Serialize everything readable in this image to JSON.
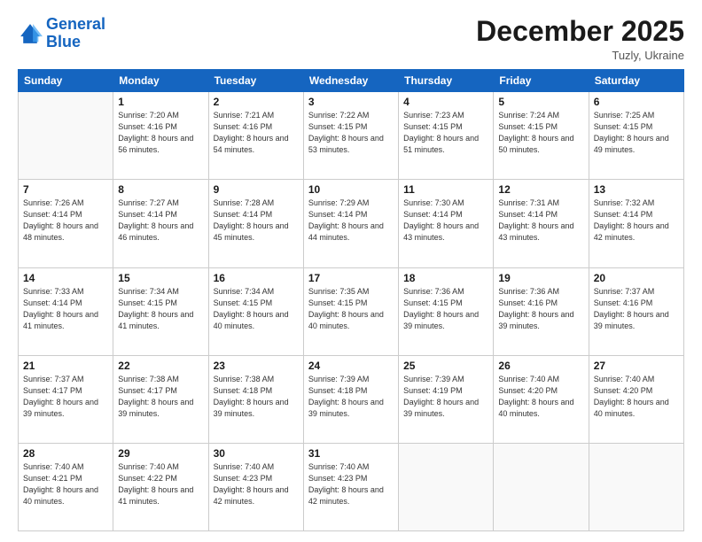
{
  "header": {
    "logo_line1": "General",
    "logo_line2": "Blue",
    "month_title": "December 2025",
    "subtitle": "Tuzly, Ukraine"
  },
  "weekdays": [
    "Sunday",
    "Monday",
    "Tuesday",
    "Wednesday",
    "Thursday",
    "Friday",
    "Saturday"
  ],
  "weeks": [
    [
      {
        "day": "",
        "sunrise": "",
        "sunset": "",
        "daylight": "",
        "empty": true
      },
      {
        "day": "1",
        "sunrise": "Sunrise: 7:20 AM",
        "sunset": "Sunset: 4:16 PM",
        "daylight": "Daylight: 8 hours and 56 minutes.",
        "empty": false
      },
      {
        "day": "2",
        "sunrise": "Sunrise: 7:21 AM",
        "sunset": "Sunset: 4:16 PM",
        "daylight": "Daylight: 8 hours and 54 minutes.",
        "empty": false
      },
      {
        "day": "3",
        "sunrise": "Sunrise: 7:22 AM",
        "sunset": "Sunset: 4:15 PM",
        "daylight": "Daylight: 8 hours and 53 minutes.",
        "empty": false
      },
      {
        "day": "4",
        "sunrise": "Sunrise: 7:23 AM",
        "sunset": "Sunset: 4:15 PM",
        "daylight": "Daylight: 8 hours and 51 minutes.",
        "empty": false
      },
      {
        "day": "5",
        "sunrise": "Sunrise: 7:24 AM",
        "sunset": "Sunset: 4:15 PM",
        "daylight": "Daylight: 8 hours and 50 minutes.",
        "empty": false
      },
      {
        "day": "6",
        "sunrise": "Sunrise: 7:25 AM",
        "sunset": "Sunset: 4:15 PM",
        "daylight": "Daylight: 8 hours and 49 minutes.",
        "empty": false
      }
    ],
    [
      {
        "day": "7",
        "sunrise": "Sunrise: 7:26 AM",
        "sunset": "Sunset: 4:14 PM",
        "daylight": "Daylight: 8 hours and 48 minutes.",
        "empty": false
      },
      {
        "day": "8",
        "sunrise": "Sunrise: 7:27 AM",
        "sunset": "Sunset: 4:14 PM",
        "daylight": "Daylight: 8 hours and 46 minutes.",
        "empty": false
      },
      {
        "day": "9",
        "sunrise": "Sunrise: 7:28 AM",
        "sunset": "Sunset: 4:14 PM",
        "daylight": "Daylight: 8 hours and 45 minutes.",
        "empty": false
      },
      {
        "day": "10",
        "sunrise": "Sunrise: 7:29 AM",
        "sunset": "Sunset: 4:14 PM",
        "daylight": "Daylight: 8 hours and 44 minutes.",
        "empty": false
      },
      {
        "day": "11",
        "sunrise": "Sunrise: 7:30 AM",
        "sunset": "Sunset: 4:14 PM",
        "daylight": "Daylight: 8 hours and 43 minutes.",
        "empty": false
      },
      {
        "day": "12",
        "sunrise": "Sunrise: 7:31 AM",
        "sunset": "Sunset: 4:14 PM",
        "daylight": "Daylight: 8 hours and 43 minutes.",
        "empty": false
      },
      {
        "day": "13",
        "sunrise": "Sunrise: 7:32 AM",
        "sunset": "Sunset: 4:14 PM",
        "daylight": "Daylight: 8 hours and 42 minutes.",
        "empty": false
      }
    ],
    [
      {
        "day": "14",
        "sunrise": "Sunrise: 7:33 AM",
        "sunset": "Sunset: 4:14 PM",
        "daylight": "Daylight: 8 hours and 41 minutes.",
        "empty": false
      },
      {
        "day": "15",
        "sunrise": "Sunrise: 7:34 AM",
        "sunset": "Sunset: 4:15 PM",
        "daylight": "Daylight: 8 hours and 41 minutes.",
        "empty": false
      },
      {
        "day": "16",
        "sunrise": "Sunrise: 7:34 AM",
        "sunset": "Sunset: 4:15 PM",
        "daylight": "Daylight: 8 hours and 40 minutes.",
        "empty": false
      },
      {
        "day": "17",
        "sunrise": "Sunrise: 7:35 AM",
        "sunset": "Sunset: 4:15 PM",
        "daylight": "Daylight: 8 hours and 40 minutes.",
        "empty": false
      },
      {
        "day": "18",
        "sunrise": "Sunrise: 7:36 AM",
        "sunset": "Sunset: 4:15 PM",
        "daylight": "Daylight: 8 hours and 39 minutes.",
        "empty": false
      },
      {
        "day": "19",
        "sunrise": "Sunrise: 7:36 AM",
        "sunset": "Sunset: 4:16 PM",
        "daylight": "Daylight: 8 hours and 39 minutes.",
        "empty": false
      },
      {
        "day": "20",
        "sunrise": "Sunrise: 7:37 AM",
        "sunset": "Sunset: 4:16 PM",
        "daylight": "Daylight: 8 hours and 39 minutes.",
        "empty": false
      }
    ],
    [
      {
        "day": "21",
        "sunrise": "Sunrise: 7:37 AM",
        "sunset": "Sunset: 4:17 PM",
        "daylight": "Daylight: 8 hours and 39 minutes.",
        "empty": false
      },
      {
        "day": "22",
        "sunrise": "Sunrise: 7:38 AM",
        "sunset": "Sunset: 4:17 PM",
        "daylight": "Daylight: 8 hours and 39 minutes.",
        "empty": false
      },
      {
        "day": "23",
        "sunrise": "Sunrise: 7:38 AM",
        "sunset": "Sunset: 4:18 PM",
        "daylight": "Daylight: 8 hours and 39 minutes.",
        "empty": false
      },
      {
        "day": "24",
        "sunrise": "Sunrise: 7:39 AM",
        "sunset": "Sunset: 4:18 PM",
        "daylight": "Daylight: 8 hours and 39 minutes.",
        "empty": false
      },
      {
        "day": "25",
        "sunrise": "Sunrise: 7:39 AM",
        "sunset": "Sunset: 4:19 PM",
        "daylight": "Daylight: 8 hours and 39 minutes.",
        "empty": false
      },
      {
        "day": "26",
        "sunrise": "Sunrise: 7:40 AM",
        "sunset": "Sunset: 4:20 PM",
        "daylight": "Daylight: 8 hours and 40 minutes.",
        "empty": false
      },
      {
        "day": "27",
        "sunrise": "Sunrise: 7:40 AM",
        "sunset": "Sunset: 4:20 PM",
        "daylight": "Daylight: 8 hours and 40 minutes.",
        "empty": false
      }
    ],
    [
      {
        "day": "28",
        "sunrise": "Sunrise: 7:40 AM",
        "sunset": "Sunset: 4:21 PM",
        "daylight": "Daylight: 8 hours and 40 minutes.",
        "empty": false
      },
      {
        "day": "29",
        "sunrise": "Sunrise: 7:40 AM",
        "sunset": "Sunset: 4:22 PM",
        "daylight": "Daylight: 8 hours and 41 minutes.",
        "empty": false
      },
      {
        "day": "30",
        "sunrise": "Sunrise: 7:40 AM",
        "sunset": "Sunset: 4:23 PM",
        "daylight": "Daylight: 8 hours and 42 minutes.",
        "empty": false
      },
      {
        "day": "31",
        "sunrise": "Sunrise: 7:40 AM",
        "sunset": "Sunset: 4:23 PM",
        "daylight": "Daylight: 8 hours and 42 minutes.",
        "empty": false
      },
      {
        "day": "",
        "sunrise": "",
        "sunset": "",
        "daylight": "",
        "empty": true
      },
      {
        "day": "",
        "sunrise": "",
        "sunset": "",
        "daylight": "",
        "empty": true
      },
      {
        "day": "",
        "sunrise": "",
        "sunset": "",
        "daylight": "",
        "empty": true
      }
    ]
  ]
}
